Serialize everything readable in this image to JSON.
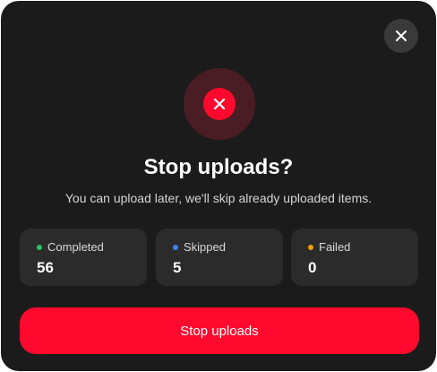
{
  "dialog": {
    "close_icon": "close-icon",
    "hero_icon": "error-x-icon",
    "title": "Stop uploads?",
    "subtitle": "You can upload later, we'll skip already uploaded items.",
    "stats": [
      {
        "label": "Completed",
        "value": "56",
        "dot_color": "#22c55e"
      },
      {
        "label": "Skipped",
        "value": "5",
        "dot_color": "#3b82f6"
      },
      {
        "label": "Failed",
        "value": "0",
        "dot_color": "#f59e0b"
      }
    ],
    "primary_button_label": "Stop uploads"
  },
  "colors": {
    "background": "#1b1b1b",
    "card": "#2b2b2b",
    "accent": "#ff0a2e",
    "accent_halo": "#4a1d24"
  }
}
